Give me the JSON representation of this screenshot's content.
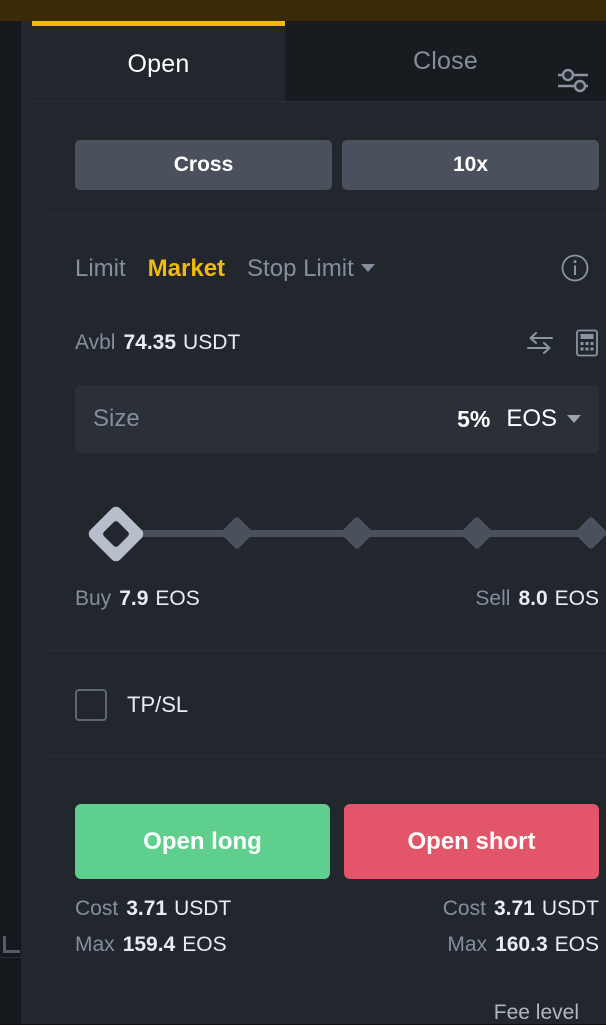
{
  "colors": {
    "accent": "#f0b90b",
    "long": "#5fcf8d",
    "short": "#e3566a",
    "panel_bg": "#22262d",
    "muted_text": "#848e9c",
    "primary_text": "#e9edf2"
  },
  "tabs": {
    "open_label": "Open",
    "close_label": "Close",
    "settings_icon": "sliders-settings-icon"
  },
  "mode": {
    "margin_label": "Cross",
    "leverage_label": "10x"
  },
  "order_types": {
    "limit_label": "Limit",
    "market_label": "Market",
    "stop_limit_label": "Stop Limit",
    "dropdown_icon": "chevron-down-icon",
    "info_icon": "info-circle-icon"
  },
  "available": {
    "label": "Avbl",
    "value": "74.35",
    "unit": "USDT",
    "transfer_icon": "transfer-arrows-icon",
    "calculator_icon": "calculator-icon"
  },
  "size": {
    "placeholder": "Size",
    "percent": "5%",
    "asset": "EOS",
    "dropdown_icon": "chevron-down-icon"
  },
  "slider": {
    "value_percent": 5,
    "stops": [
      0,
      25,
      50,
      75,
      100
    ]
  },
  "estimates": {
    "buy_label": "Buy",
    "buy_value": "7.9",
    "buy_unit": "EOS",
    "sell_label": "Sell",
    "sell_value": "8.0",
    "sell_unit": "EOS"
  },
  "tpsl": {
    "label": "TP/SL",
    "checked": false
  },
  "actions": {
    "long_label": "Open long",
    "short_label": "Open short"
  },
  "summary": {
    "long": {
      "cost_label": "Cost",
      "cost_value": "3.71",
      "cost_unit": "USDT",
      "max_label": "Max",
      "max_value": "159.4",
      "max_unit": "EOS"
    },
    "short": {
      "cost_label": "Cost",
      "cost_value": "3.71",
      "cost_unit": "USDT",
      "max_label": "Max",
      "max_value": "160.3",
      "max_unit": "EOS"
    }
  },
  "footer": {
    "fee_level_label": "Fee level"
  }
}
